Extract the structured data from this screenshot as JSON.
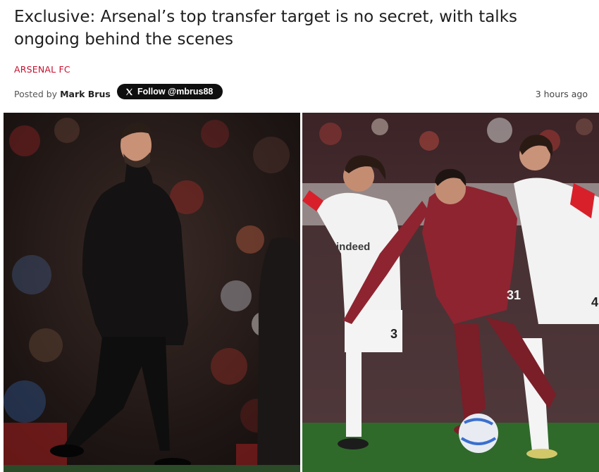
{
  "article": {
    "headline": "Exclusive: Arsenal’s top transfer target is no secret, with talks ongoing behind the scenes",
    "category": "ARSENAL FC",
    "byline_prefix": "Posted by",
    "author": "Mark Brus",
    "follow_label": "Follow @mbrus88",
    "timestamp": "3 hours ago"
  },
  "images": {
    "left": {
      "subject": "manager-on-touchline",
      "kit_color": "#1a1a1a"
    },
    "right": {
      "subject": "football-match-tackle",
      "player_kit_color": "#8e2430",
      "opponent_kit_color": "#f2f2f2",
      "opponent_accent": "#d8202b",
      "pitch_color": "#2f6a2a",
      "sponsor_text": "indeed",
      "shirt_numbers": [
        "3",
        "31",
        "4"
      ]
    }
  },
  "colors": {
    "accent": "#c8102e",
    "follow_bg": "#0f0f0f"
  }
}
